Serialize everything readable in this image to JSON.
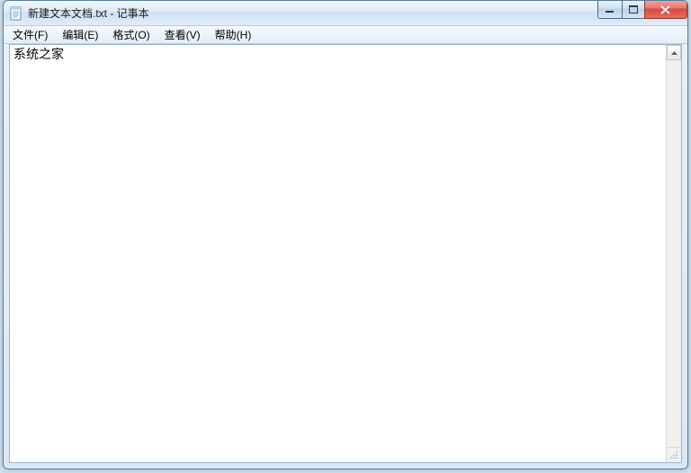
{
  "window": {
    "title": "新建文本文档.txt - 记事本"
  },
  "menu": {
    "file": "文件(F)",
    "edit": "编辑(E)",
    "format": "格式(O)",
    "view": "查看(V)",
    "help": "帮助(H)"
  },
  "editor": {
    "content": "系统之家"
  }
}
